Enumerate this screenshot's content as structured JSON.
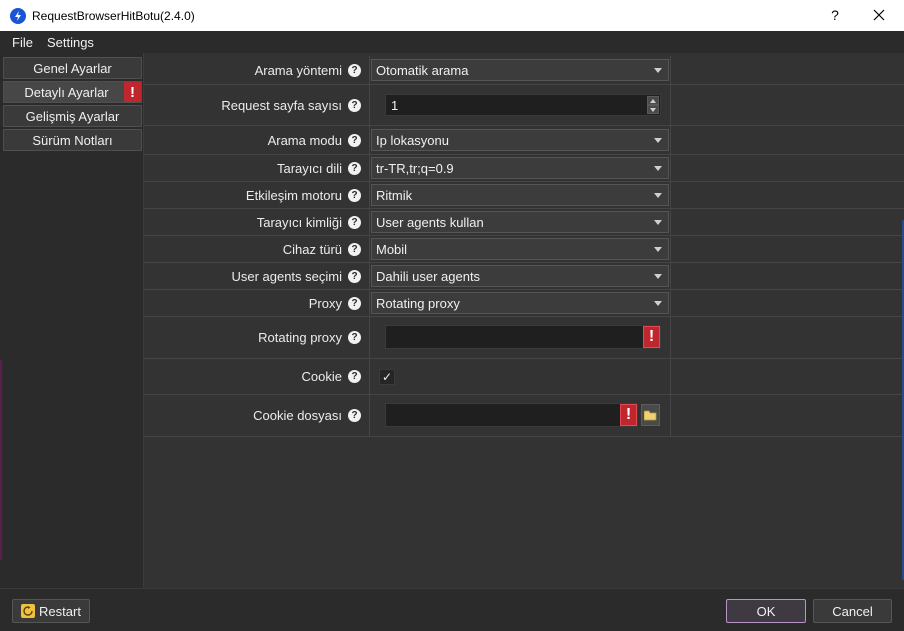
{
  "window": {
    "title": "RequestBrowserHitBotu(2.4.0)",
    "help": "?",
    "close": "✕"
  },
  "menu": {
    "file": "File",
    "settings": "Settings"
  },
  "sidebar": {
    "items": [
      {
        "label": "Genel Ayarlar"
      },
      {
        "label": "Detaylı Ayarlar",
        "warning": "!"
      },
      {
        "label": "Gelişmiş Ayarlar"
      },
      {
        "label": "Sürüm Notları"
      }
    ]
  },
  "form": {
    "arama_yontemi": {
      "label": "Arama yöntemi",
      "value": "Otomatik arama"
    },
    "request_sayfa": {
      "label": "Request sayfa sayısı",
      "value": "1"
    },
    "arama_modu": {
      "label": "Arama modu",
      "value": "Ip lokasyonu"
    },
    "tarayici_dili": {
      "label": "Tarayıcı dili",
      "value": "tr-TR,tr;q=0.9"
    },
    "etkilesim": {
      "label": "Etkileşim motoru",
      "value": "Ritmik"
    },
    "tarayici_kimligi": {
      "label": "Tarayıcı kimliği",
      "value": "User agents kullan"
    },
    "cihaz_turu": {
      "label": "Cihaz türü",
      "value": "Mobil"
    },
    "ua_secimi": {
      "label": "User agents seçimi",
      "value": "Dahili user agents"
    },
    "proxy": {
      "label": "Proxy",
      "value": "Rotating proxy"
    },
    "rotating_proxy": {
      "label": "Rotating proxy",
      "value": "",
      "warning": "!"
    },
    "cookie": {
      "label": "Cookie",
      "checked": true,
      "check": "✓"
    },
    "cookie_dosyasi": {
      "label": "Cookie dosyası",
      "value": "",
      "warning": "!"
    }
  },
  "help_glyph": "?",
  "footer": {
    "restart": "Restart",
    "ok": "OK",
    "cancel": "Cancel"
  },
  "colors": {
    "warning": "#c0262d",
    "accent": "#b894c8",
    "app_icon": "#1a55d6"
  }
}
